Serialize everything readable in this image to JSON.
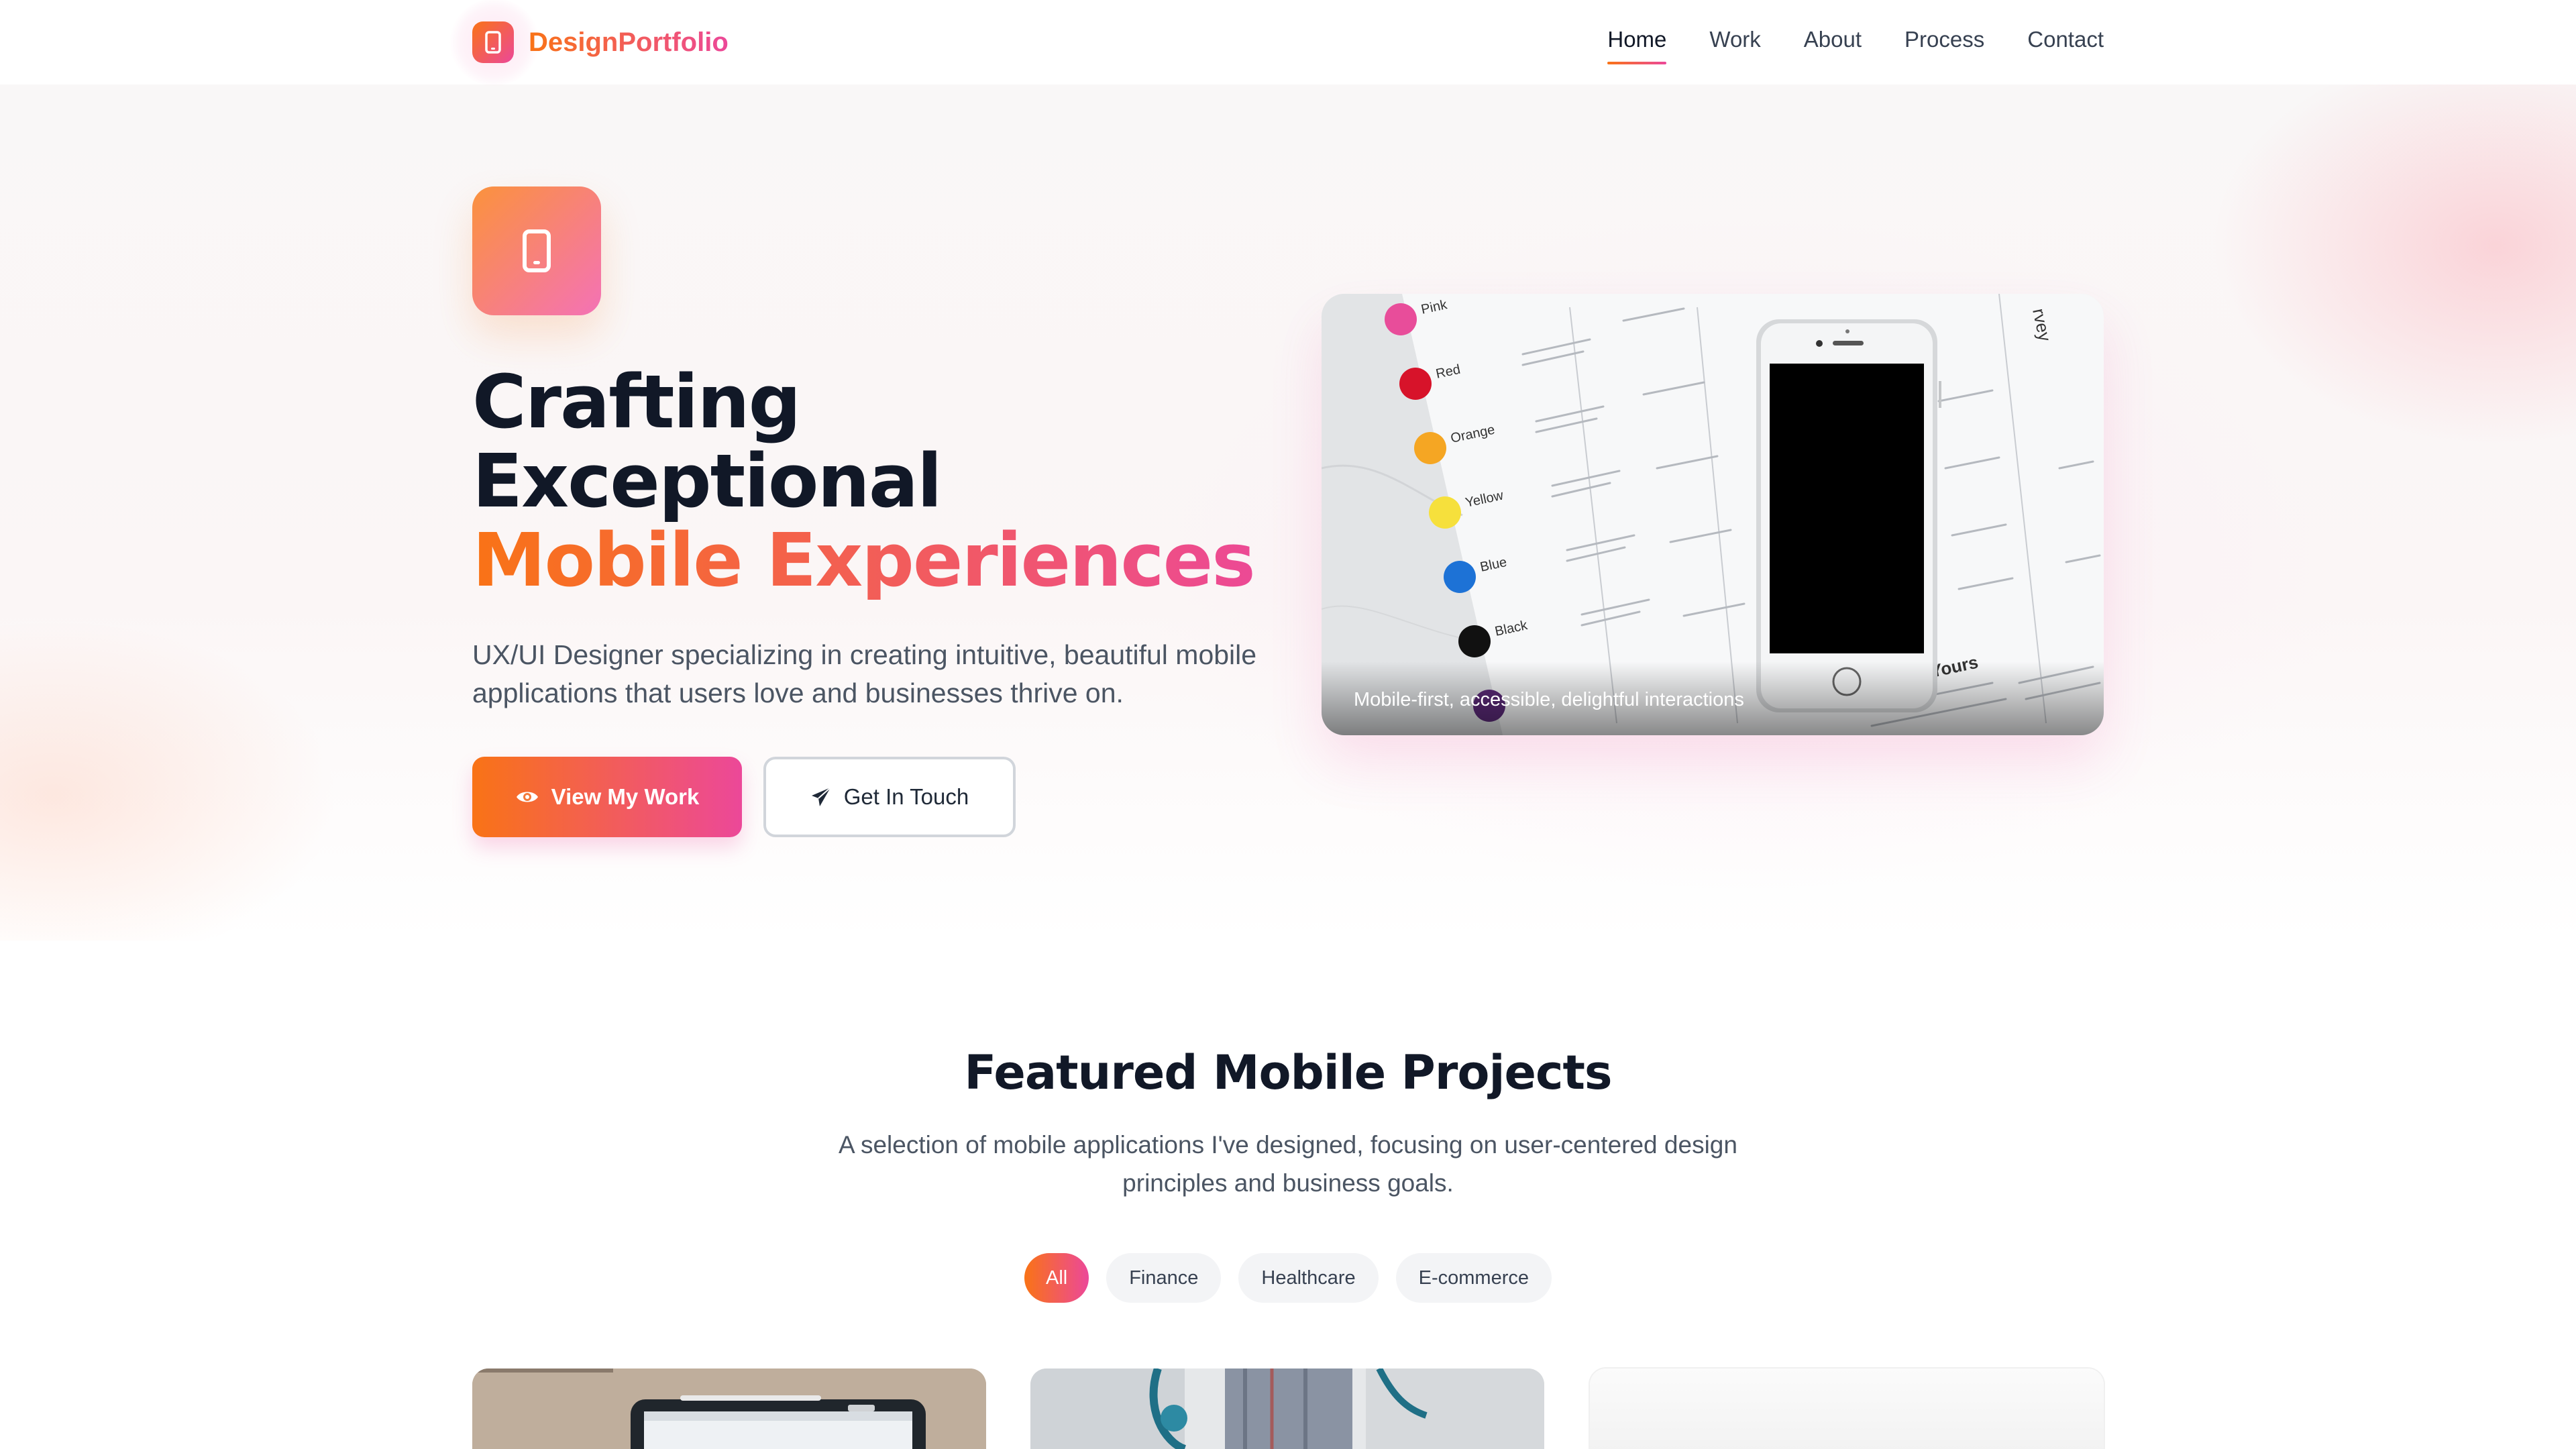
{
  "brand": {
    "name": "DesignPortfolio",
    "icon": "smartphone-icon"
  },
  "nav": {
    "items": [
      {
        "label": "Home",
        "active": true
      },
      {
        "label": "Work",
        "active": false
      },
      {
        "label": "About",
        "active": false
      },
      {
        "label": "Process",
        "active": false
      },
      {
        "label": "Contact",
        "active": false
      }
    ]
  },
  "hero": {
    "icon": "smartphone-icon",
    "title_line1": "Crafting",
    "title_line2": "Exceptional",
    "title_highlight": "Mobile Experiences",
    "subtitle": "UX/UI Designer specializing in creating intuitive, beautiful mobile applications that users love and businesses thrive on.",
    "primary_button": {
      "label": "View My Work",
      "icon": "eye-icon"
    },
    "secondary_button": {
      "label": "Get In Touch",
      "icon": "paper-plane-icon"
    },
    "image_caption": "Mobile-first, accessible, delightful interactions",
    "image_labels": [
      "Pink",
      "Red",
      "Orange",
      "Yellow",
      "Blue",
      "Black",
      "Yours",
      "rvey"
    ]
  },
  "projects": {
    "title": "Featured Mobile Projects",
    "subtitle": "A selection of mobile applications I've designed, focusing on user-centered design principles and business goals.",
    "filters": [
      {
        "label": "All",
        "active": true
      },
      {
        "label": "Finance",
        "active": false
      },
      {
        "label": "Healthcare",
        "active": false
      },
      {
        "label": "E-commerce",
        "active": false
      }
    ]
  },
  "colors": {
    "accent_start": "#f97316",
    "accent_end": "#ec4899",
    "text_dark": "#111827",
    "text_muted": "#4b5563"
  }
}
